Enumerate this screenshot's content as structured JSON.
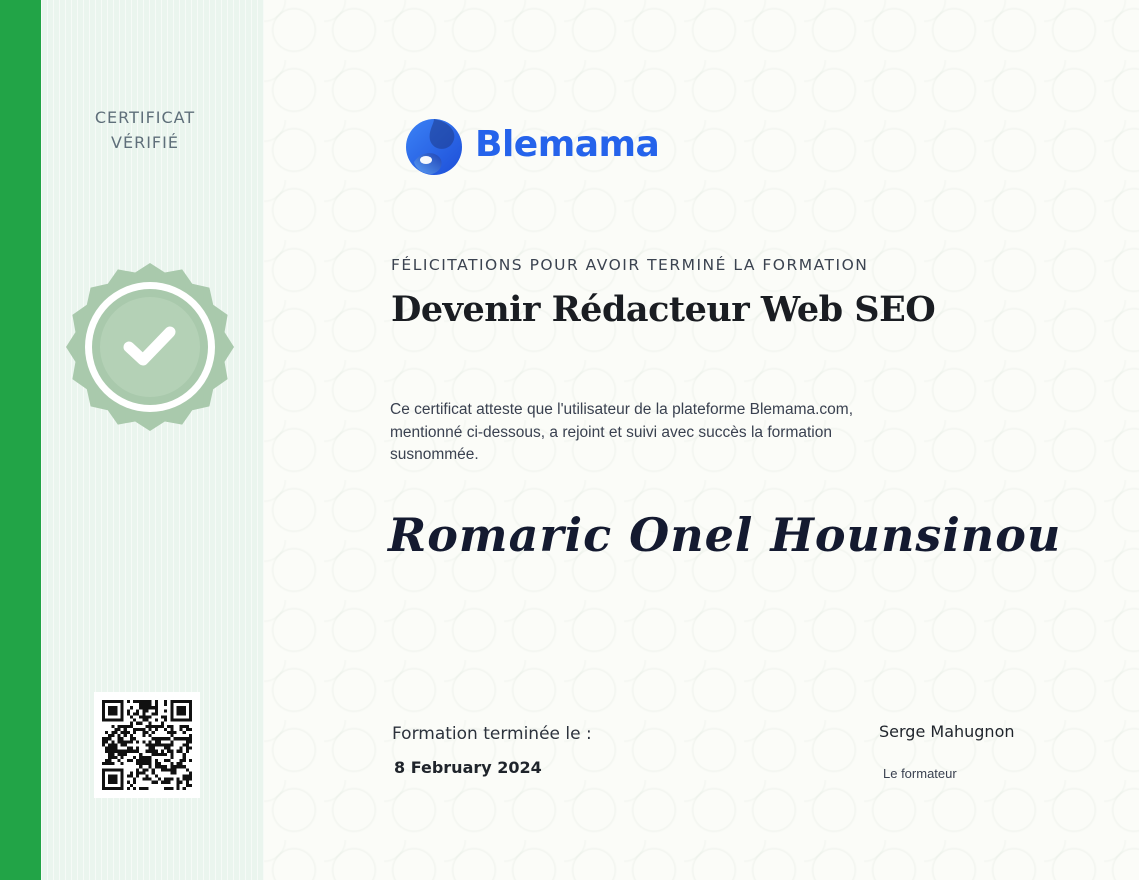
{
  "sidebar": {
    "verified_line1": "CERTIFICAT",
    "verified_line2": "VÉRIFIÉ",
    "badge_icon": "check-seal-icon",
    "qr_icon": "qr-code-icon"
  },
  "logo": {
    "text": "Blemama",
    "icon": "blemama-logo-icon"
  },
  "certificate": {
    "congrats": "FÉLICITATIONS POUR AVOIR TERMINÉ LA FORMATION",
    "course_title": "Devenir Rédacteur Web SEO",
    "description": "Ce certificat atteste que l'utilisateur de la plateforme Blemama.com, mentionné ci-dessous, a rejoint et suivi avec succès la formation susnommée.",
    "student_name": "Romaric Onel Hounsinou",
    "date_label": "Formation terminée le :",
    "date_value": "8 February 2024",
    "trainer_name": "Serge Mahugnon",
    "trainer_role": "Le formateur"
  },
  "colors": {
    "accent_green": "#22a447",
    "sidebar_bg": "#eaf5ee",
    "badge_green": "#a9c9ac",
    "brand_blue": "#2563eb"
  }
}
